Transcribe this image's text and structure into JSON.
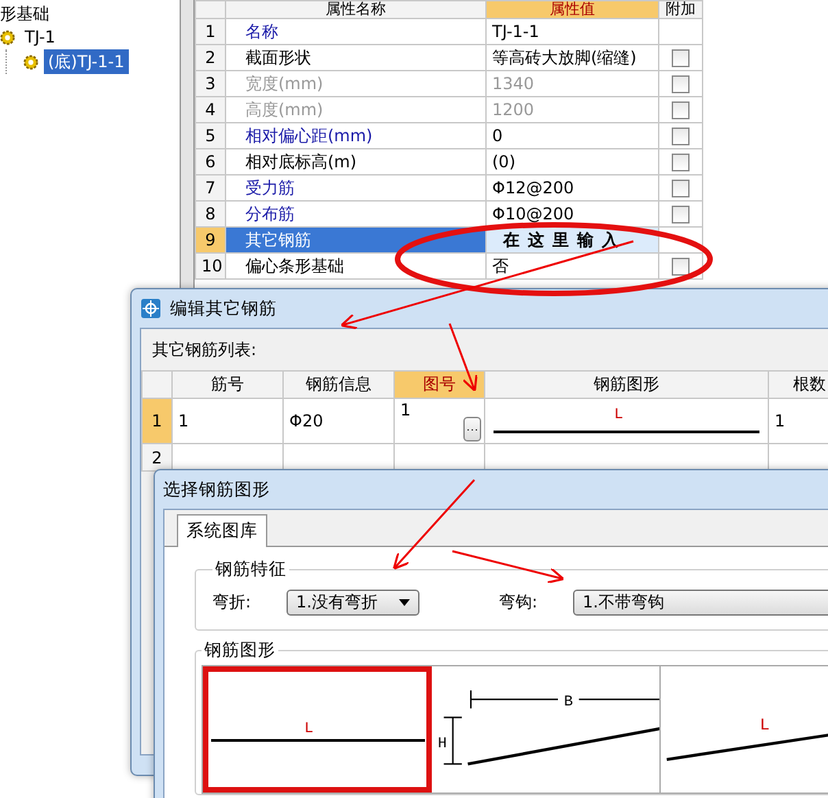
{
  "tree": {
    "root": "形基础",
    "items": [
      {
        "label": "TJ-1",
        "selected": false,
        "children": [
          {
            "label": "(底)TJ-1-1",
            "selected": true
          }
        ]
      }
    ]
  },
  "property_grid": {
    "columns": [
      {
        "label": "属性名称",
        "selected": false
      },
      {
        "label": "属性值",
        "selected": true
      },
      {
        "label": "附加",
        "selected": false
      }
    ],
    "rows": [
      {
        "num": "1",
        "name": "名称",
        "kind": "required",
        "value": "TJ-1-1",
        "selected": false
      },
      {
        "num": "2",
        "name": "截面形状",
        "kind": "normal",
        "value": "等高砖大放脚(缩缝)",
        "checked": false,
        "selected": false
      },
      {
        "num": "3",
        "name": "宽度(mm)",
        "kind": "readonly",
        "value": "1340",
        "checked": false,
        "selected": false
      },
      {
        "num": "4",
        "name": "高度(mm)",
        "kind": "readonly",
        "value": "1200",
        "checked": false,
        "selected": false
      },
      {
        "num": "5",
        "name": "相对偏心距(mm)",
        "kind": "required",
        "value": "0",
        "checked": false,
        "selected": false
      },
      {
        "num": "6",
        "name": "相对底标高(m)",
        "kind": "normal",
        "value": "(0)",
        "checked": false,
        "selected": false
      },
      {
        "num": "7",
        "name": "受力筋",
        "kind": "required",
        "value": "Φ12@200",
        "checked": false,
        "selected": false
      },
      {
        "num": "8",
        "name": "分布筋",
        "kind": "required",
        "value": "Φ10@200",
        "checked": false,
        "selected": false
      },
      {
        "num": "9",
        "name": "其它钢筋",
        "kind": "normal",
        "value": "在这里输入",
        "selected": true
      },
      {
        "num": "10",
        "name": "偏心条形基础",
        "kind": "normal",
        "value": "否",
        "checked": false,
        "selected": false
      }
    ]
  },
  "edit_dialog": {
    "title": "编辑其它钢筋",
    "list_label": "其它钢筋列表:",
    "columns": [
      {
        "label": "筋号",
        "selected": false
      },
      {
        "label": "钢筋信息",
        "selected": false
      },
      {
        "label": "图号",
        "selected": true
      },
      {
        "label": "钢筋图形",
        "selected": false
      },
      {
        "label": "根数",
        "selected": false
      }
    ],
    "rows": [
      {
        "num": "1",
        "selected": true,
        "bar_no": "1",
        "info": "Φ20",
        "figure_no": "1",
        "browse_label": "···",
        "shape_label": "L",
        "count": "1"
      },
      {
        "num": "2",
        "selected": false
      }
    ]
  },
  "shape_dialog": {
    "title": "选择钢筋图形",
    "tabs": [
      {
        "label": "系统图库",
        "selected": true
      }
    ],
    "features_group": "钢筋特征",
    "fields": [
      {
        "label": "弯折:",
        "value": "1.没有弯折"
      },
      {
        "label": "弯钩:",
        "value": "1.不带弯钩"
      }
    ],
    "shapes_group": "钢筋图形",
    "shapes": [
      {
        "kind": "straight",
        "labels": [
          "L"
        ],
        "selected": true
      },
      {
        "kind": "dimensioned-slope",
        "labels": [
          "H",
          "B"
        ],
        "selected": false
      },
      {
        "kind": "slope",
        "labels": [
          "L"
        ],
        "selected": false
      }
    ]
  }
}
